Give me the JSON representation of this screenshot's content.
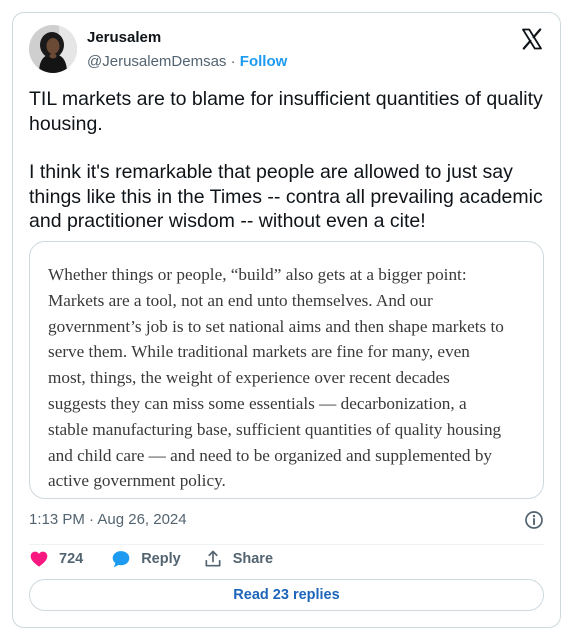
{
  "author": {
    "display_name": "Jerusalem",
    "handle": "@JerusalemDemsas",
    "separator": "·",
    "follow_label": "Follow"
  },
  "tweet": {
    "paragraphs": [
      "TIL markets are to blame for insufficient quantities of quality housing.",
      "I think it's remarkable that people are allowed to just say things like this in the Times -- contra all prevailing academic and practitioner wisdom -- without even a cite!"
    ],
    "quote_lines": [
      "Whether things or people, “build” also gets at a bigger point:",
      "Markets are a tool, not an end unto themselves. And our",
      "government’s job is to set national aims and then shape markets to",
      "serve them. While traditional markets are fine for many, even",
      "most, things, the weight of experience over recent decades",
      "suggests they can miss some essentials — decarbonization, a",
      "stable manufacturing base, sufficient quantities of quality housing",
      "and child care — and need to be organized and supplemented by",
      "active government policy."
    ],
    "timestamp": "1:13 PM · Aug 26, 2024"
  },
  "actions": {
    "likes": "724",
    "reply_label": "Reply",
    "share_label": "Share"
  },
  "read_replies_label": "Read 23 replies",
  "icons": {
    "like": "heart-icon",
    "reply": "speech-bubble-icon",
    "share": "share-upload-icon",
    "info": "info-icon",
    "brand": "x-logo-icon"
  },
  "colors": {
    "like": "#f91880",
    "reply": "#1d9bf0",
    "link": "#1d9bf0",
    "muted": "#536471",
    "border": "#cfd9de"
  }
}
